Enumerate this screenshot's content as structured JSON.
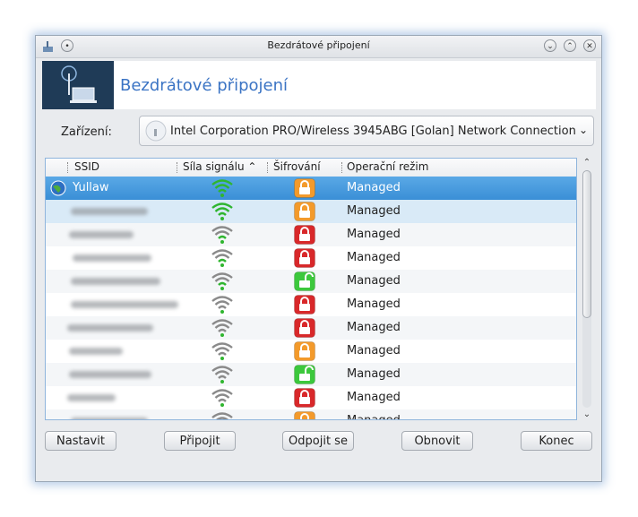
{
  "window": {
    "title": "Bezdrátové připojení"
  },
  "banner": {
    "title": "Bezdrátové připojení"
  },
  "device": {
    "label": "Zařízení:",
    "value": "Intel Corporation PRO/Wireless 3945ABG [Golan] Network Connection"
  },
  "table": {
    "columns": [
      "SSID",
      "Síla signálu",
      "Šifrování",
      "Operační režim"
    ],
    "sort_column": "Síla signálu",
    "rows": [
      {
        "ssid": "Yullaw",
        "signal": "strong",
        "lock": "orange",
        "mode": "Managed",
        "selected": true
      },
      {
        "ssid": "",
        "signal": "strong",
        "lock": "orange",
        "mode": "Managed"
      },
      {
        "ssid": "",
        "signal": "medium",
        "lock": "red",
        "mode": "Managed"
      },
      {
        "ssid": "",
        "signal": "medium",
        "lock": "red",
        "mode": "Managed"
      },
      {
        "ssid": "",
        "signal": "medium",
        "lock": "green",
        "mode": "Managed"
      },
      {
        "ssid": "",
        "signal": "weak",
        "lock": "red",
        "mode": "Managed"
      },
      {
        "ssid": "",
        "signal": "weak",
        "lock": "red",
        "mode": "Managed"
      },
      {
        "ssid": "",
        "signal": "weak",
        "lock": "orange",
        "mode": "Managed"
      },
      {
        "ssid": "",
        "signal": "weak",
        "lock": "green",
        "mode": "Managed"
      },
      {
        "ssid": "",
        "signal": "weak",
        "lock": "red",
        "mode": "Managed"
      },
      {
        "ssid": "",
        "signal": "weak",
        "lock": "orange",
        "mode": "Managed"
      }
    ]
  },
  "buttons": {
    "configure": "Nastavit",
    "connect": "Připojit",
    "disconnect": "Odpojit se",
    "refresh": "Obnovit",
    "quit": "Konec"
  },
  "colors": {
    "accent": "#3b74c4",
    "selection": "#3a8fd6",
    "signal_on": "#2fb52f",
    "signal_off": "#8a8a8a",
    "lock_orange": "#f39a2b",
    "lock_red": "#d8282a",
    "lock_green": "#3cc83c"
  }
}
